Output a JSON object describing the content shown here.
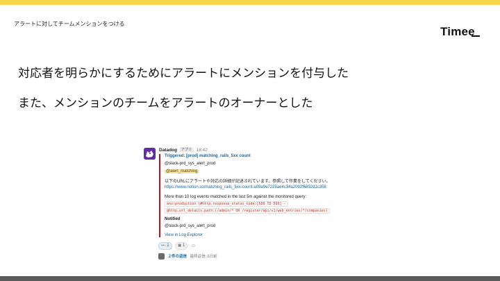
{
  "slide": {
    "header_label": "アラートに対してチームメンションをつける",
    "logo": "Timee",
    "headline_1": "対応者を明らかにするためにアラートにメンションを付与した",
    "headline_2": "また、メンションのチームをアラートのオーナーとした"
  },
  "colors": {
    "top_bar": "#f7d84a",
    "bottom_bar": "#5b5b5b",
    "attachment_border": "#b5121b",
    "link": "#1264a3",
    "datadog_purple": "#632ca6"
  },
  "message": {
    "bot_name": "Datadog",
    "app_badge": "アプリ",
    "time": "18:42",
    "title": "Triggered: [prod] matching_rails_5xx count",
    "mention_top": "@slack-prd_sys_alert_prod",
    "mention_team": "@alert_matching",
    "jp_note": "以下のURLにアラートや対応の詳細が記述されています。参照して作業をしてください。",
    "notion_url": "https://www.notion.so/matching_rails_5xx-count-a09a9e7225ae4c34a2092f6892d1c358",
    "query_text": "More than 10 log events matched in the last 5m against the monitored query:",
    "query_code_1": "env:production \\#http.response_status_code:[500 TO 599] -",
    "query_code_2": "@http.url_details.path:(/admin/* OR /register/api/v1/web_entries/*/companies)",
    "notified_label": "Notified",
    "notified_target": "@slack-prd_sys_alert_prod",
    "log_explorer_link": "View in Log Explorer",
    "reactions": [
      {
        "icon": "eyes-icon",
        "glyph": "👀",
        "count": "1"
      },
      {
        "icon": "custom-emoji-icon",
        "glyph": "▦",
        "count": "1"
      }
    ],
    "add_reaction_glyph": "☺",
    "thread_replies": "２件の返信",
    "thread_last_reply": "最終返信: 6日前"
  }
}
